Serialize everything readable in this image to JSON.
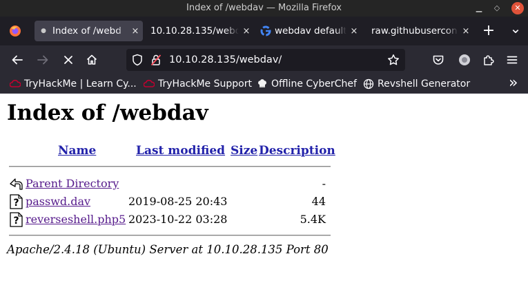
{
  "window": {
    "title": "Index of /webdav — Mozilla Firefox"
  },
  "tabs": [
    {
      "title": "Index of /webd",
      "active": true,
      "icon": "loading-dot-icon"
    },
    {
      "title": "10.10.28.135/webd",
      "active": false,
      "icon": ""
    },
    {
      "title": "webdav default",
      "active": false,
      "icon": "google-icon"
    },
    {
      "title": "raw.githubusercon",
      "active": false,
      "icon": ""
    }
  ],
  "tab_close_glyph": "×",
  "new_tab_glyph": "+",
  "list_all_tabs_glyph": "⌄",
  "urlbar": {
    "url": "10.10.28.135/webdav/"
  },
  "bookmarks": [
    {
      "label": "TryHackMe | Learn Cy...",
      "icon": "tryhackme-icon"
    },
    {
      "label": "TryHackMe Support",
      "icon": "tryhackme-icon"
    },
    {
      "label": "Offline CyberChef",
      "icon": "chef-hat-icon"
    },
    {
      "label": "Revshell Generator",
      "icon": "globe-icon"
    }
  ],
  "bookmarks_overflow_glyph": "»",
  "page": {
    "heading": "Index of /webdav",
    "columns": {
      "name": "Name",
      "last_modified": "Last modified",
      "size": "Size",
      "description": "Description"
    },
    "rows": [
      {
        "name": "Parent Directory",
        "date": "",
        "size": "-",
        "icon": "back-arrow-icon"
      },
      {
        "name": "passwd.dav",
        "date": "2019-08-25 20:43",
        "size": "44",
        "icon": "unknown-file-icon"
      },
      {
        "name": "reverseshell.php5",
        "date": "2023-10-22 03:28",
        "size": "5.4K",
        "icon": "unknown-file-icon"
      }
    ],
    "address": "Apache/2.4.18 (Ubuntu) Server at 10.10.28.135 Port 80"
  },
  "colors": {
    "titlebar_bg": "#252525",
    "tabstrip_bg": "#1f1e25",
    "toolbar_bg": "#2b2a33",
    "urlbar_bg": "#1c1b22",
    "link_color": "#2222aa",
    "visited_link_color": "#551a8b",
    "close_button": "#e0533a"
  }
}
